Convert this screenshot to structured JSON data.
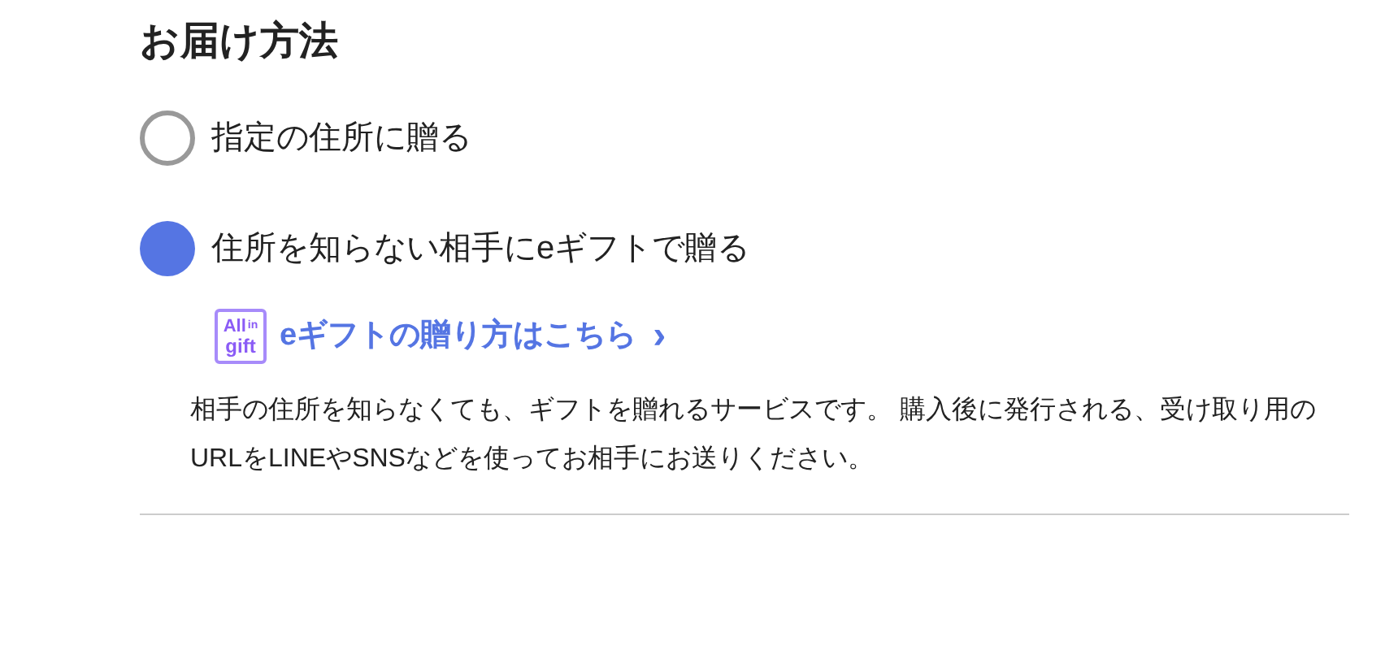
{
  "heading": "お届け方法",
  "options": [
    {
      "label": "指定の住所に贈る",
      "selected": false
    },
    {
      "label": "住所を知らない相手にeギフトで贈る",
      "selected": true
    }
  ],
  "guide_link": {
    "logo_top": "All",
    "logo_side": "in",
    "logo_bottom": "gift",
    "label": "eギフトの贈り方はこちら",
    "chevron": "›"
  },
  "description": "相手の住所を知らなくても、ギフトを贈れるサービスです。 購入後に発行される、受け取り用のURLをLINEやSNSなどを使ってお相手にお送りください。"
}
